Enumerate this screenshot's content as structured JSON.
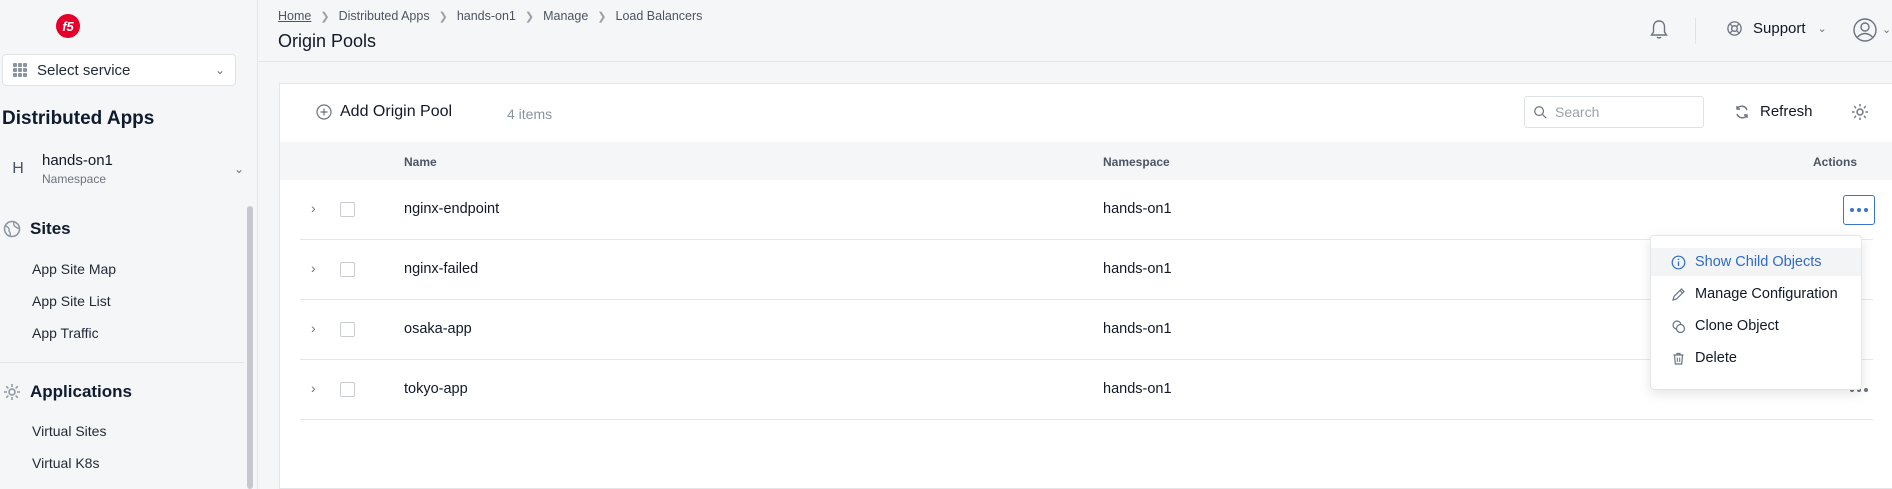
{
  "logo": "f5",
  "service_select": {
    "label": "Select service"
  },
  "app_title": "Distributed Apps",
  "namespace": {
    "badge": "H",
    "name": "hands-on1",
    "label": "Namespace"
  },
  "sites": {
    "heading": "Sites",
    "items": [
      {
        "label": "App Site Map"
      },
      {
        "label": "App Site List"
      },
      {
        "label": "App Traffic"
      }
    ]
  },
  "applications": {
    "heading": "Applications",
    "items": [
      {
        "label": "Virtual Sites"
      },
      {
        "label": "Virtual K8s"
      }
    ]
  },
  "breadcrumb": [
    "Home",
    "Distributed Apps",
    "hands-on1",
    "Manage",
    "Load Balancers"
  ],
  "page_title": "Origin Pools",
  "header": {
    "support_label": "Support"
  },
  "toolbar": {
    "add_label": "Add Origin Pool",
    "count": "4 items",
    "search_placeholder": "Search",
    "refresh_label": "Refresh"
  },
  "table": {
    "columns": {
      "name": "Name",
      "namespace": "Namespace",
      "actions": "Actions"
    },
    "rows": [
      {
        "name": "nginx-endpoint",
        "namespace": "hands-on1"
      },
      {
        "name": "nginx-failed",
        "namespace": "hands-on1"
      },
      {
        "name": "osaka-app",
        "namespace": "hands-on1"
      },
      {
        "name": "tokyo-app",
        "namespace": "hands-on1"
      }
    ]
  },
  "actions_menu": [
    {
      "label": "Show Child Objects",
      "icon": "info-icon"
    },
    {
      "label": "Manage Configuration",
      "icon": "pencil-icon"
    },
    {
      "label": "Clone Object",
      "icon": "clone-icon"
    },
    {
      "label": "Delete",
      "icon": "trash-icon"
    }
  ],
  "colors": {
    "accent": "#3b73c9",
    "brand": "#e4002b"
  }
}
